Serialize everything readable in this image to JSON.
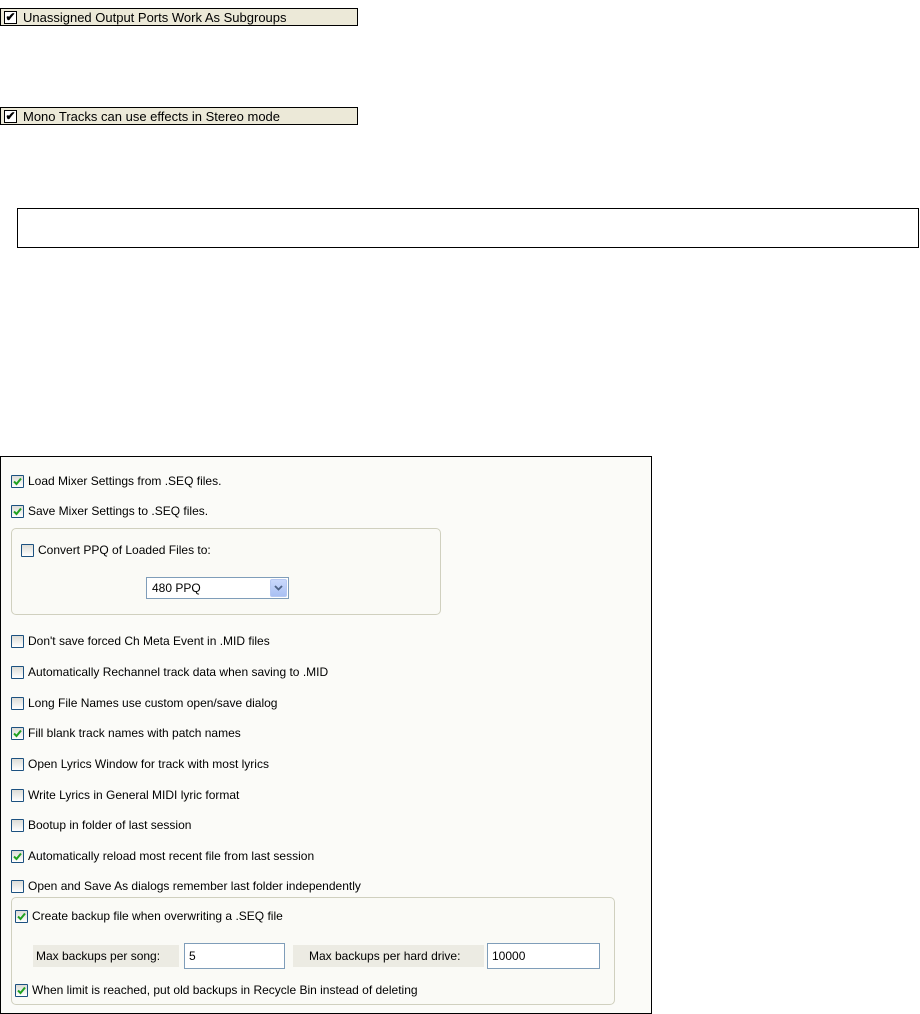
{
  "top_options": [
    {
      "label": "Unassigned Output Ports Work As Subgroups",
      "checked": true
    },
    {
      "label": "Mono Tracks can use effects in Stereo mode",
      "checked": true
    }
  ],
  "empty_field": {
    "value": ""
  },
  "panel": {
    "load_mixer": {
      "label": "Load Mixer Settings from .SEQ files.",
      "checked": true
    },
    "save_mixer": {
      "label": "Save Mixer Settings to .SEQ files.",
      "checked": true
    },
    "convert_ppq": {
      "label": "Convert PPQ of Loaded Files to:",
      "checked": false,
      "select_value": "480 PPQ"
    },
    "options": [
      {
        "label": "Don't save forced Ch Meta Event in .MID files",
        "checked": false
      },
      {
        "label": "Automatically Rechannel track data when saving to .MID",
        "checked": false
      },
      {
        "label": "Long File Names use custom open/save dialog",
        "checked": false
      },
      {
        "label": "Fill blank track names with patch names",
        "checked": true
      },
      {
        "label": "Open Lyrics Window for track with most lyrics",
        "checked": false
      },
      {
        "label": "Write Lyrics in General MIDI lyric format",
        "checked": false
      },
      {
        "label": "Bootup in folder of last session",
        "checked": false
      },
      {
        "label": "Automatically reload most recent file from last session",
        "checked": true
      },
      {
        "label": "Open and Save As dialogs remember last folder independently",
        "checked": false
      }
    ],
    "backup": {
      "create": {
        "label": "Create backup file when overwriting a .SEQ file",
        "checked": true
      },
      "max_per_song_label": "Max backups per song:",
      "max_per_song_value": "5",
      "max_per_drive_label": "Max backups per hard drive:",
      "max_per_drive_value": "10000",
      "recycle": {
        "label": "When limit is reached, put old backups in Recycle Bin instead of deleting",
        "checked": true
      }
    },
    "colors": {
      "check": "#21a121",
      "checkbox_border": "#1c5180",
      "frame": "#d0d0bf"
    }
  }
}
